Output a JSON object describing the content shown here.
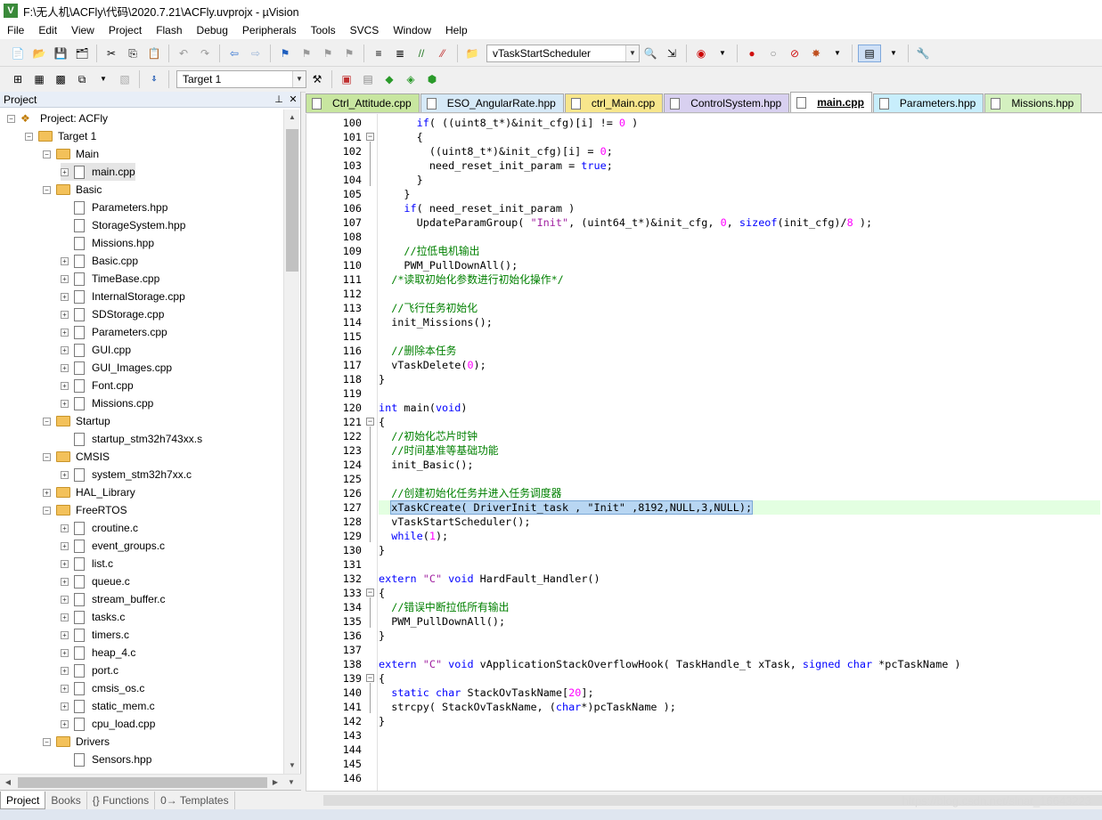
{
  "window": {
    "title": "F:\\无人机\\ACFly\\代码\\2020.7.21\\ACFly.uvprojx - µVision"
  },
  "menu": [
    "File",
    "Edit",
    "View",
    "Project",
    "Flash",
    "Debug",
    "Peripherals",
    "Tools",
    "SVCS",
    "Window",
    "Help"
  ],
  "toolbar1": {
    "function_combo": "vTaskStartScheduler"
  },
  "toolbar2": {
    "target_combo": "Target 1"
  },
  "project_panel": {
    "title": "Project",
    "tree": [
      {
        "label": "Project: ACFly",
        "level": 0,
        "kind": "project",
        "exp": "-"
      },
      {
        "label": "Target 1",
        "level": 1,
        "kind": "folder",
        "exp": "-"
      },
      {
        "label": "Main",
        "level": 2,
        "kind": "folder",
        "exp": "-"
      },
      {
        "label": "main.cpp",
        "level": 3,
        "kind": "file",
        "exp": "+",
        "selected": true
      },
      {
        "label": "Basic",
        "level": 2,
        "kind": "folder",
        "exp": "-"
      },
      {
        "label": "Parameters.hpp",
        "level": 3,
        "kind": "file",
        "exp": ""
      },
      {
        "label": "StorageSystem.hpp",
        "level": 3,
        "kind": "file",
        "exp": ""
      },
      {
        "label": "Missions.hpp",
        "level": 3,
        "kind": "file",
        "exp": ""
      },
      {
        "label": "Basic.cpp",
        "level": 3,
        "kind": "file",
        "exp": "+"
      },
      {
        "label": "TimeBase.cpp",
        "level": 3,
        "kind": "file",
        "exp": "+"
      },
      {
        "label": "InternalStorage.cpp",
        "level": 3,
        "kind": "file",
        "exp": "+"
      },
      {
        "label": "SDStorage.cpp",
        "level": 3,
        "kind": "file",
        "exp": "+"
      },
      {
        "label": "Parameters.cpp",
        "level": 3,
        "kind": "file",
        "exp": "+"
      },
      {
        "label": "GUI.cpp",
        "level": 3,
        "kind": "file",
        "exp": "+"
      },
      {
        "label": "GUI_Images.cpp",
        "level": 3,
        "kind": "file",
        "exp": "+"
      },
      {
        "label": "Font.cpp",
        "level": 3,
        "kind": "file",
        "exp": "+"
      },
      {
        "label": "Missions.cpp",
        "level": 3,
        "kind": "file",
        "exp": "+"
      },
      {
        "label": "Startup",
        "level": 2,
        "kind": "folder",
        "exp": "-"
      },
      {
        "label": "startup_stm32h743xx.s",
        "level": 3,
        "kind": "file",
        "exp": ""
      },
      {
        "label": "CMSIS",
        "level": 2,
        "kind": "folder",
        "exp": "-"
      },
      {
        "label": "system_stm32h7xx.c",
        "level": 3,
        "kind": "file",
        "exp": "+"
      },
      {
        "label": "HAL_Library",
        "level": 2,
        "kind": "folder",
        "exp": "+"
      },
      {
        "label": "FreeRTOS",
        "level": 2,
        "kind": "folder",
        "exp": "-"
      },
      {
        "label": "croutine.c",
        "level": 3,
        "kind": "file",
        "exp": "+"
      },
      {
        "label": "event_groups.c",
        "level": 3,
        "kind": "file",
        "exp": "+"
      },
      {
        "label": "list.c",
        "level": 3,
        "kind": "file",
        "exp": "+"
      },
      {
        "label": "queue.c",
        "level": 3,
        "kind": "file",
        "exp": "+"
      },
      {
        "label": "stream_buffer.c",
        "level": 3,
        "kind": "file",
        "exp": "+"
      },
      {
        "label": "tasks.c",
        "level": 3,
        "kind": "file",
        "exp": "+"
      },
      {
        "label": "timers.c",
        "level": 3,
        "kind": "file",
        "exp": "+"
      },
      {
        "label": "heap_4.c",
        "level": 3,
        "kind": "file",
        "exp": "+"
      },
      {
        "label": "port.c",
        "level": 3,
        "kind": "file",
        "exp": "+"
      },
      {
        "label": "cmsis_os.c",
        "level": 3,
        "kind": "file",
        "exp": "+"
      },
      {
        "label": "static_mem.c",
        "level": 3,
        "kind": "file",
        "exp": "+"
      },
      {
        "label": "cpu_load.cpp",
        "level": 3,
        "kind": "file",
        "exp": "+"
      },
      {
        "label": "Drivers",
        "level": 2,
        "kind": "folder",
        "exp": "-"
      },
      {
        "label": "Sensors.hpp",
        "level": 3,
        "kind": "file",
        "exp": ""
      }
    ]
  },
  "bottom_tabs": [
    "Project",
    "Books",
    "{} Functions",
    "0→ Templates"
  ],
  "editor_tabs": [
    {
      "label": "Ctrl_Attitude.cpp",
      "color": "#c8e6a0"
    },
    {
      "label": "ESO_AngularRate.hpp",
      "color": "#d6e9f7"
    },
    {
      "label": "ctrl_Main.cpp",
      "color": "#f7e68c"
    },
    {
      "label": "ControlSystem.hpp",
      "color": "#d8d0f0"
    },
    {
      "label": "main.cpp",
      "color": "#ffffff",
      "active": true
    },
    {
      "label": "Parameters.hpp",
      "color": "#c8eefc"
    },
    {
      "label": "Missions.hpp",
      "color": "#d4f0c0"
    }
  ],
  "code_lines": [
    {
      "n": "100",
      "fold": "",
      "t": [
        [
          "",
          "      "
        ],
        [
          "kw",
          "if"
        ],
        [
          "",
          "( ((uint8_t*)&init_cfg)[i] != "
        ],
        [
          "num",
          "0"
        ],
        [
          "",
          " )"
        ]
      ]
    },
    {
      "n": "101",
      "fold": "-",
      "t": [
        [
          "",
          "      {"
        ]
      ]
    },
    {
      "n": "102",
      "fold": "",
      "t": [
        [
          "",
          "        ((uint8_t*)&init_cfg)[i] = "
        ],
        [
          "num",
          "0"
        ],
        [
          "",
          ";"
        ]
      ]
    },
    {
      "n": "103",
      "fold": "",
      "t": [
        [
          "",
          "        need_reset_init_param = "
        ],
        [
          "kw",
          "true"
        ],
        [
          "",
          ";"
        ]
      ]
    },
    {
      "n": "104",
      "fold": "",
      "t": [
        [
          "",
          "      }"
        ]
      ]
    },
    {
      "n": "105",
      "fold": "",
      "t": [
        [
          "",
          "    }"
        ]
      ]
    },
    {
      "n": "106",
      "fold": "",
      "t": [
        [
          "",
          "    "
        ],
        [
          "kw",
          "if"
        ],
        [
          "",
          "( need_reset_init_param )"
        ]
      ]
    },
    {
      "n": "107",
      "fold": "",
      "t": [
        [
          "",
          "      UpdateParamGroup( "
        ],
        [
          "str",
          "\"Init\""
        ],
        [
          "",
          ", (uint64_t*)&init_cfg, "
        ],
        [
          "num",
          "0"
        ],
        [
          "",
          ", "
        ],
        [
          "kw",
          "sizeof"
        ],
        [
          "",
          "(init_cfg)/"
        ],
        [
          "num",
          "8"
        ],
        [
          "",
          " );"
        ]
      ]
    },
    {
      "n": "108",
      "fold": "",
      "t": [
        [
          "",
          ""
        ]
      ]
    },
    {
      "n": "109",
      "fold": "",
      "t": [
        [
          "",
          "    "
        ],
        [
          "cm",
          "//拉低电机输出"
        ]
      ]
    },
    {
      "n": "110",
      "fold": "",
      "t": [
        [
          "",
          "    PWM_PullDownAll();"
        ]
      ]
    },
    {
      "n": "111",
      "fold": "",
      "t": [
        [
          "",
          "  "
        ],
        [
          "cm",
          "/*读取初始化参数进行初始化操作*/"
        ]
      ]
    },
    {
      "n": "112",
      "fold": "",
      "t": [
        [
          "",
          ""
        ]
      ]
    },
    {
      "n": "113",
      "fold": "",
      "t": [
        [
          "",
          "  "
        ],
        [
          "cm",
          "//飞行任务初始化"
        ]
      ]
    },
    {
      "n": "114",
      "fold": "",
      "t": [
        [
          "",
          "  init_Missions();"
        ]
      ]
    },
    {
      "n": "115",
      "fold": "",
      "t": [
        [
          "",
          ""
        ]
      ]
    },
    {
      "n": "116",
      "fold": "",
      "t": [
        [
          "",
          "  "
        ],
        [
          "cm",
          "//删除本任务"
        ]
      ]
    },
    {
      "n": "117",
      "fold": "",
      "t": [
        [
          "",
          "  vTaskDelete("
        ],
        [
          "num",
          "0"
        ],
        [
          "",
          ");"
        ]
      ]
    },
    {
      "n": "118",
      "fold": "",
      "t": [
        [
          "",
          "}"
        ]
      ]
    },
    {
      "n": "119",
      "fold": "",
      "t": [
        [
          "",
          ""
        ]
      ]
    },
    {
      "n": "120",
      "fold": "",
      "t": [
        [
          "kw",
          "int"
        ],
        [
          "",
          " main("
        ],
        [
          "kw",
          "void"
        ],
        [
          "",
          ")"
        ]
      ]
    },
    {
      "n": "121",
      "fold": "-",
      "t": [
        [
          "",
          "{"
        ]
      ]
    },
    {
      "n": "122",
      "fold": "",
      "t": [
        [
          "",
          "  "
        ],
        [
          "cm",
          "//初始化芯片时钟"
        ]
      ]
    },
    {
      "n": "123",
      "fold": "",
      "t": [
        [
          "",
          "  "
        ],
        [
          "cm",
          "//时间基准等基础功能"
        ]
      ]
    },
    {
      "n": "124",
      "fold": "",
      "t": [
        [
          "",
          "  init_Basic();"
        ]
      ]
    },
    {
      "n": "125",
      "fold": "",
      "t": [
        [
          "",
          ""
        ]
      ]
    },
    {
      "n": "126",
      "fold": "",
      "t": [
        [
          "",
          "  "
        ],
        [
          "cm",
          "//创建初始化任务并进入任务调度器"
        ]
      ]
    },
    {
      "n": "127",
      "fold": "",
      "hl": true,
      "t": [
        [
          "",
          "  "
        ],
        [
          "sel",
          "xTaskCreate( DriverInit_task , \"Init\" ,8192,NULL,3,NULL);"
        ]
      ]
    },
    {
      "n": "128",
      "fold": "",
      "t": [
        [
          "",
          "  vTaskStartScheduler();"
        ]
      ]
    },
    {
      "n": "129",
      "fold": "",
      "t": [
        [
          "",
          "  "
        ],
        [
          "kw",
          "while"
        ],
        [
          "",
          "("
        ],
        [
          "num",
          "1"
        ],
        [
          "",
          ");"
        ]
      ]
    },
    {
      "n": "130",
      "fold": "",
      "t": [
        [
          "",
          "}"
        ]
      ]
    },
    {
      "n": "131",
      "fold": "",
      "t": [
        [
          "",
          ""
        ]
      ]
    },
    {
      "n": "132",
      "fold": "",
      "t": [
        [
          "kw",
          "extern"
        ],
        [
          "",
          " "
        ],
        [
          "str",
          "\"C\""
        ],
        [
          "",
          " "
        ],
        [
          "kw",
          "void"
        ],
        [
          "",
          " HardFault_Handler()"
        ]
      ]
    },
    {
      "n": "133",
      "fold": "-",
      "t": [
        [
          "",
          "{"
        ]
      ]
    },
    {
      "n": "134",
      "fold": "",
      "t": [
        [
          "",
          "  "
        ],
        [
          "cm",
          "//错误中断拉低所有输出"
        ]
      ]
    },
    {
      "n": "135",
      "fold": "",
      "t": [
        [
          "",
          "  PWM_PullDownAll();"
        ]
      ]
    },
    {
      "n": "136",
      "fold": "",
      "t": [
        [
          "",
          "}"
        ]
      ]
    },
    {
      "n": "137",
      "fold": "",
      "t": [
        [
          "",
          ""
        ]
      ]
    },
    {
      "n": "138",
      "fold": "",
      "t": [
        [
          "kw",
          "extern"
        ],
        [
          "",
          " "
        ],
        [
          "str",
          "\"C\""
        ],
        [
          "",
          " "
        ],
        [
          "kw",
          "void"
        ],
        [
          "",
          " vApplicationStackOverflowHook( TaskHandle_t xTask, "
        ],
        [
          "kw",
          "signed"
        ],
        [
          "",
          " "
        ],
        [
          "kw",
          "char"
        ],
        [
          "",
          " *pcTaskName )"
        ]
      ]
    },
    {
      "n": "139",
      "fold": "-",
      "t": [
        [
          "",
          "{"
        ]
      ]
    },
    {
      "n": "140",
      "fold": "",
      "t": [
        [
          "",
          "  "
        ],
        [
          "kw",
          "static"
        ],
        [
          "",
          " "
        ],
        [
          "kw",
          "char"
        ],
        [
          "",
          " StackOvTaskName["
        ],
        [
          "num",
          "20"
        ],
        [
          "",
          "];"
        ]
      ]
    },
    {
      "n": "141",
      "fold": "",
      "t": [
        [
          "",
          "  strcpy( StackOvTaskName, ("
        ],
        [
          "kw",
          "char"
        ],
        [
          "",
          "*)pcTaskName );"
        ]
      ]
    },
    {
      "n": "142",
      "fold": "",
      "t": [
        [
          "",
          "}"
        ]
      ]
    },
    {
      "n": "143",
      "fold": "",
      "t": [
        [
          "",
          ""
        ]
      ]
    },
    {
      "n": "144",
      "fold": "",
      "t": [
        [
          "",
          ""
        ]
      ]
    },
    {
      "n": "145",
      "fold": "",
      "t": [
        [
          "",
          ""
        ]
      ]
    },
    {
      "n": "146",
      "fold": "",
      "t": [
        [
          "",
          ""
        ]
      ]
    }
  ],
  "watermark": "https://blog.csdn.net/sinat_16643223"
}
